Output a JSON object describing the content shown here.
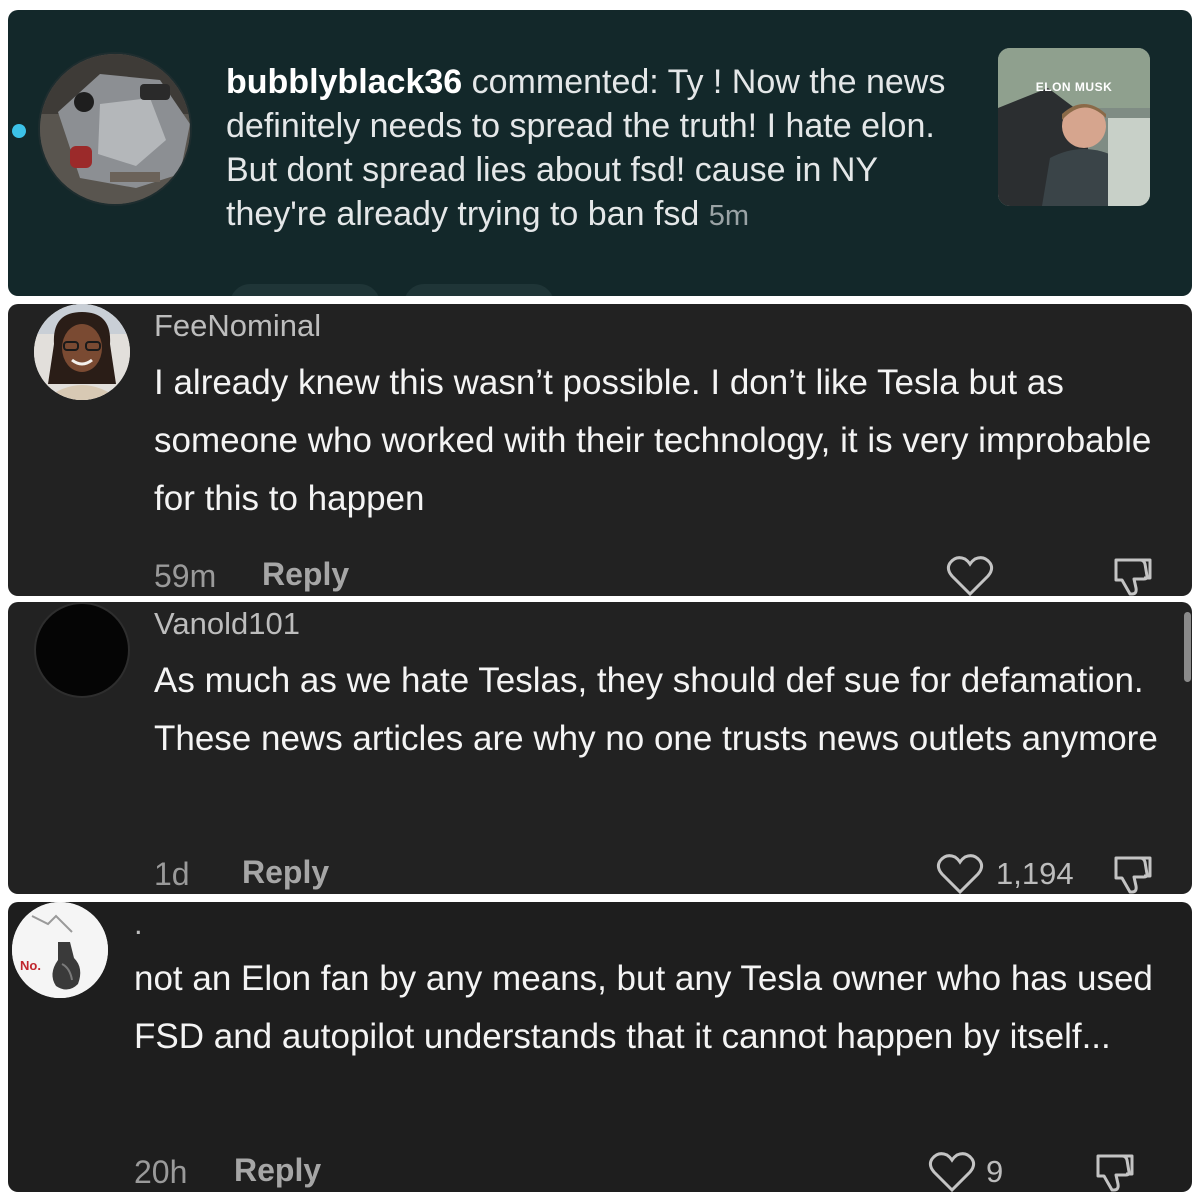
{
  "notification": {
    "username": "bubblyblack36",
    "message": " commented: Ty ! Now the news definitely needs to spread the truth! I hate elon. But dont spread lies about fsd! cause in NY they're already trying to ban fsd",
    "time": "5m",
    "thumbnail_label": "ELON MUSK"
  },
  "comments": [
    {
      "username": "FeeNominal",
      "text": "I already knew this wasn’t possible. I don’t like Tesla but as someone who worked with their technology, it is very improbable for this to happen",
      "time": "59m",
      "reply_label": "Reply",
      "like_count": ""
    },
    {
      "username": "Vanold101",
      "text": "As much as we hate Teslas, they should def sue for defamation. These news articles are why no one trusts news outlets anymore",
      "time": "1d",
      "reply_label": "Reply",
      "like_count": "1,194"
    },
    {
      "username": ".",
      "text": "not an Elon fan by any means, but any Tesla owner who has used FSD and autopilot understands that it cannot happen by itself...",
      "time": "20h",
      "reply_label": "Reply",
      "like_count": "9",
      "avatar_text": "No."
    }
  ],
  "colors": {
    "notification_bg": "#13282a",
    "comment_bg": "#222222",
    "unread_dot": "#3cc2e8"
  },
  "icons": [
    "heart-icon",
    "dislike-icon"
  ]
}
